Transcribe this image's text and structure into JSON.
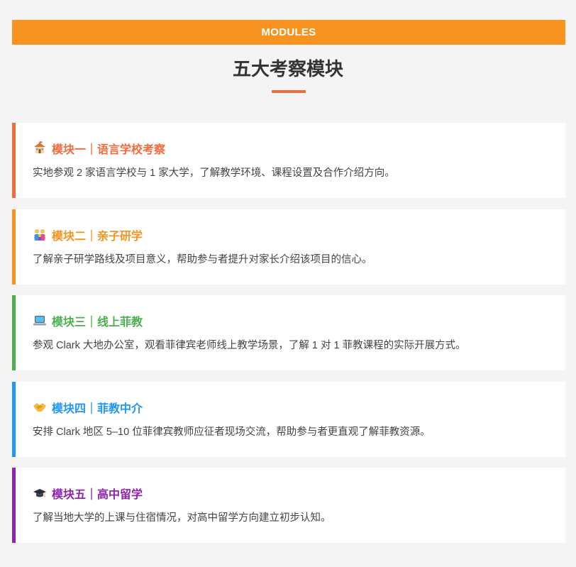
{
  "header": {
    "banner_label": "MODULES",
    "title": "五大考察模块"
  },
  "colors": {
    "banner": "#f7931e",
    "underline": "#f26b3a",
    "module1": "#f26b3a",
    "module2": "#f7931e",
    "module3": "#4caf50",
    "module4": "#2196f3",
    "module5": "#8e24aa"
  },
  "modules": [
    {
      "icon": "school-icon",
      "title": "模块一｜语言学校考察",
      "description": "实地参观 2 家语言学校与 1 家大学，了解教学环境、课程设置及合作介绍方向。"
    },
    {
      "icon": "family-icon",
      "title": "模块二｜亲子研学",
      "description": "了解亲子研学路线及项目意义，帮助参与者提升对家长介绍该项目的信心。"
    },
    {
      "icon": "laptop-icon",
      "title": "模块三｜线上菲教",
      "description": "参观 Clark 大地办公室，观看菲律宾老师线上教学场景，了解 1 对 1 菲教课程的实际开展方式。"
    },
    {
      "icon": "handshake-icon",
      "title": "模块四｜菲教中介",
      "description": "安排 Clark 地区 5–10 位菲律宾教师应征者现场交流，帮助参与者更直观了解菲教资源。"
    },
    {
      "icon": "graduation-cap-icon",
      "title": "模块五｜高中留学",
      "description": "了解当地大学的上课与住宿情况，对高中留学方向建立初步认知。"
    }
  ]
}
